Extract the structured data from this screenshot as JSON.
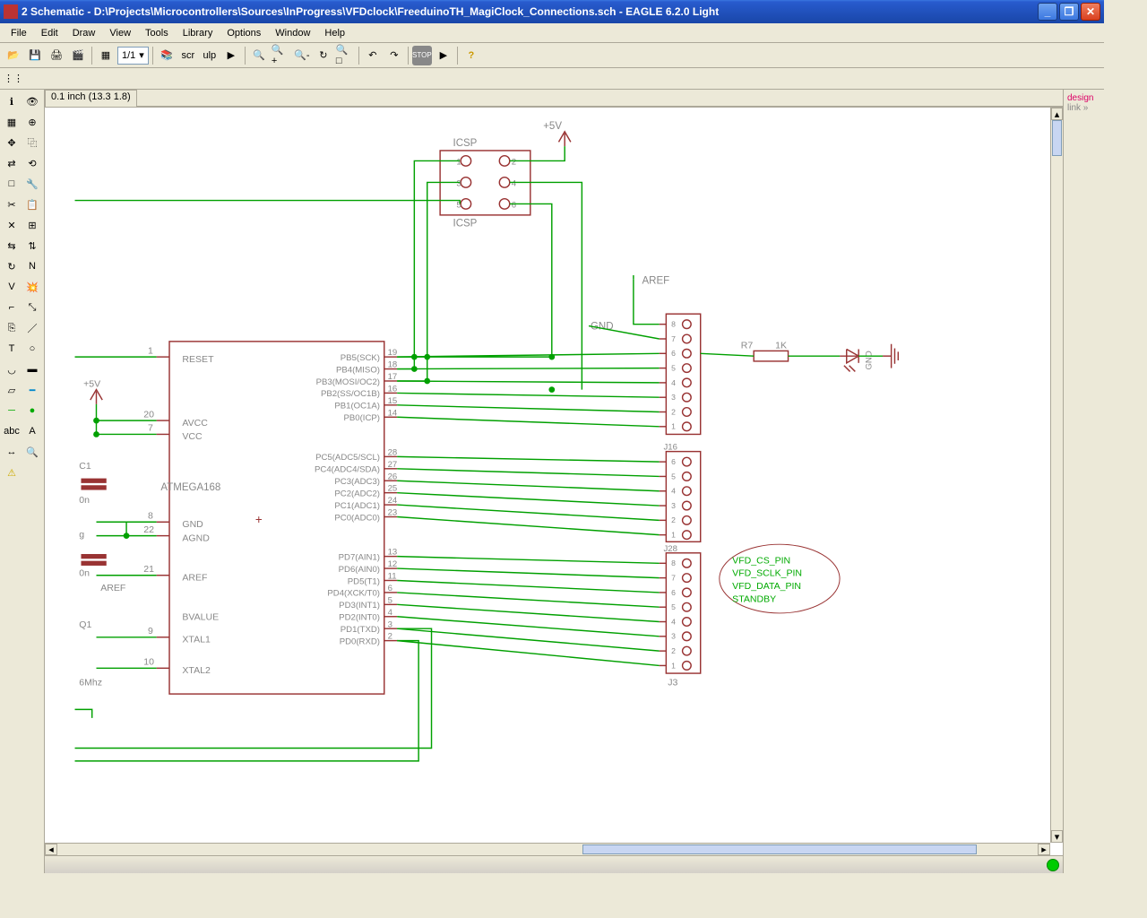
{
  "title": "2 Schematic - D:\\Projects\\Microcontrollers\\Sources\\InProgress\\VFDclock\\FreeduinoTH_MagiClock_Connections.sch - EAGLE 6.2.0 Light",
  "menu": [
    "File",
    "Edit",
    "Draw",
    "View",
    "Tools",
    "Library",
    "Options",
    "Window",
    "Help"
  ],
  "sheet": "1/1",
  "coord": "0.1 inch (13.3 1.8)",
  "chip": {
    "name": "ATMEGA168",
    "left": [
      {
        "n": "1",
        "lbl": "RESET"
      },
      {
        "n": "20",
        "lbl": "AVCC"
      },
      {
        "n": "7",
        "lbl": "VCC"
      },
      {
        "n": "8",
        "lbl": "GND"
      },
      {
        "n": "22",
        "lbl": "AGND"
      },
      {
        "n": "21",
        "lbl": "AREF"
      },
      {
        "n": "",
        "lbl": "BVALUE"
      },
      {
        "n": "9",
        "lbl": "XTAL1"
      },
      {
        "n": "10",
        "lbl": "XTAL2"
      }
    ],
    "right": [
      {
        "n": "19",
        "lbl": "PB5(SCK)"
      },
      {
        "n": "18",
        "lbl": "PB4(MISO)"
      },
      {
        "n": "17",
        "lbl": "PB3(MOSI/OC2)"
      },
      {
        "n": "16",
        "lbl": "PB2(SS/OC1B)"
      },
      {
        "n": "15",
        "lbl": "PB1(OC1A)"
      },
      {
        "n": "14",
        "lbl": "PB0(ICP)"
      },
      {
        "n": "28",
        "lbl": "PC5(ADC5/SCL)"
      },
      {
        "n": "27",
        "lbl": "PC4(ADC4/SDA)"
      },
      {
        "n": "26",
        "lbl": "PC3(ADC3)"
      },
      {
        "n": "25",
        "lbl": "PC2(ADC2)"
      },
      {
        "n": "24",
        "lbl": "PC1(ADC1)"
      },
      {
        "n": "23",
        "lbl": "PC0(ADC0)"
      },
      {
        "n": "13",
        "lbl": "PD7(AIN1)"
      },
      {
        "n": "12",
        "lbl": "PD6(AIN0)"
      },
      {
        "n": "11",
        "lbl": "PD5(T1)"
      },
      {
        "n": "6",
        "lbl": "PD4(XCK/T0)"
      },
      {
        "n": "5",
        "lbl": "PD3(INT1)"
      },
      {
        "n": "4",
        "lbl": "PD2(INT0)"
      },
      {
        "n": "3",
        "lbl": "PD1(TXD)"
      },
      {
        "n": "2",
        "lbl": "PD0(RXD)"
      }
    ]
  },
  "icsp": "ICSP",
  "icsp_pins": [
    "1",
    "2",
    "3",
    "4",
    "5",
    "6"
  ],
  "headers": {
    "j1": {
      "name": "",
      "pins": [
        "8",
        "7",
        "6",
        "5",
        "4",
        "3",
        "2",
        "1"
      ]
    },
    "j16": {
      "name": "J16",
      "pins": [
        "6",
        "5",
        "4",
        "3",
        "2",
        "1"
      ]
    },
    "j2": {
      "name": "J28",
      "pins": [
        "8",
        "7",
        "6",
        "5",
        "4",
        "3",
        "2",
        "1"
      ]
    },
    "j3": {
      "name": "J3"
    }
  },
  "labels": {
    "p5v": "+5V",
    "aref": "AREF",
    "gnd": "GND",
    "r7": "R7",
    "r7v": "1K",
    "gndR": "GND",
    "c1": "C1",
    "c1v": "0n",
    "q1": "Q1",
    "mhz": "6Mhz",
    "aref2": "AREF",
    "g": "g"
  },
  "annot": [
    "VFD_CS_PIN",
    "VFD_SCLK_PIN",
    "VFD_DATA_PIN",
    "STANDBY"
  ],
  "rightpanel": {
    "design": "design",
    "link": "link",
    "arrow": "»"
  }
}
